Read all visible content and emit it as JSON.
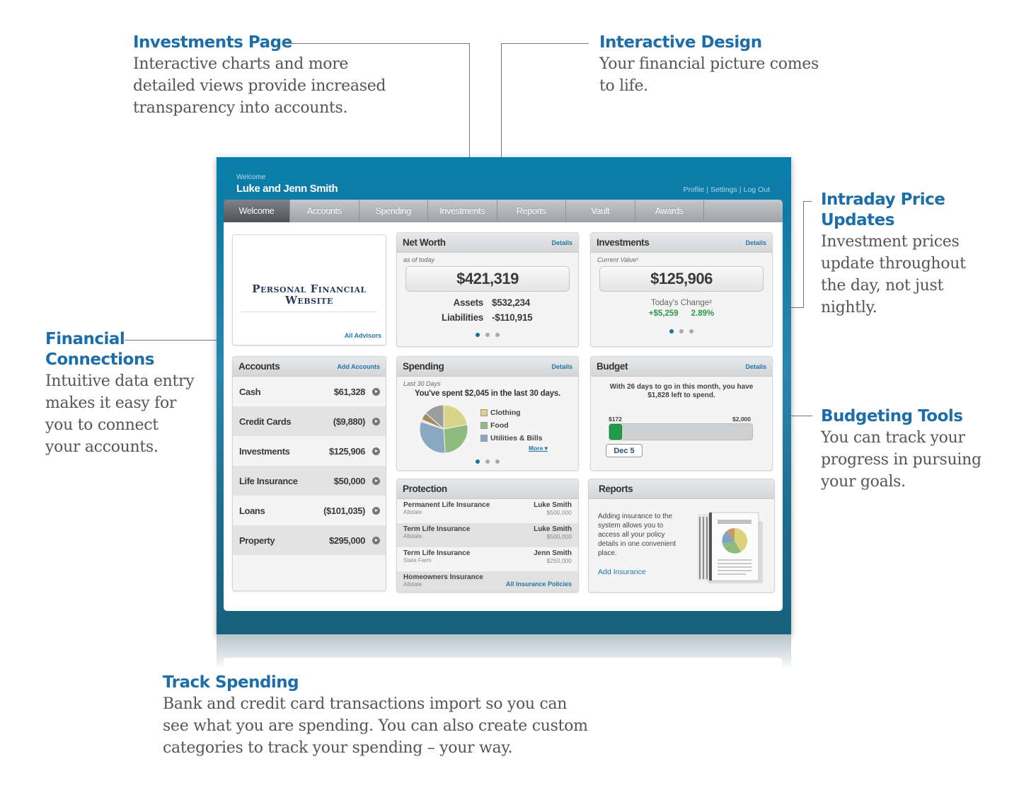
{
  "callouts": {
    "investments_page": {
      "title": "Investments Page",
      "lines": [
        "Interactive charts and more",
        "detailed views provide increased",
        "transparency into accounts."
      ]
    },
    "interactive_design": {
      "title": "Interactive Design",
      "lines": [
        "Your financial picture comes",
        "to life."
      ]
    },
    "intraday": {
      "title_lines": [
        "Intraday Price",
        "Updates"
      ],
      "lines": [
        "Investment prices",
        "update throughout",
        "the day, not just",
        "nightly."
      ]
    },
    "financial_connections": {
      "title_lines": [
        "Financial",
        "Connections"
      ],
      "lines": [
        "Intuitive data entry",
        "makes it easy for",
        "you to connect",
        "your accounts."
      ]
    },
    "budgeting_tools": {
      "title": "Budgeting Tools",
      "lines": [
        "You can track your",
        "progress in pursuing",
        "your goals."
      ]
    },
    "track_spending": {
      "title": "Track Spending",
      "lines": [
        "Bank and credit card transactions import so you can",
        "see what you are spending. You can also create custom",
        "categories to track your spending – your way."
      ]
    }
  },
  "header": {
    "welcome": "Welcome",
    "user_name": "Luke and Jenn Smith",
    "links": [
      "Profile",
      "Settings",
      "Log Out"
    ],
    "separator": "|"
  },
  "nav": {
    "tabs": [
      "Welcome",
      "Accounts",
      "Spending",
      "Investments",
      "Reports",
      "Vault",
      "Awards"
    ],
    "active": "Welcome"
  },
  "logo": {
    "line1": "Personal Financial",
    "line2": "Website",
    "all_advisors": "All Advisors"
  },
  "net_worth": {
    "title": "Net Worth",
    "details": "Details",
    "subtitle": "as of today",
    "total": "$421,319",
    "assets_label": "Assets",
    "assets": "$532,234",
    "liabilities_label": "Liabilities",
    "liabilities": "-$110,915",
    "page_index": 1,
    "page_count": 3
  },
  "investments": {
    "title": "Investments",
    "details": "Details",
    "subtitle": "Current Value¹",
    "total": "$125,906",
    "change_label": "Today's Change²",
    "change_amount": "+$5,259",
    "change_percent": "2.89%",
    "change_color": "#2b9a4d",
    "page_index": 1,
    "page_count": 3
  },
  "accounts": {
    "title": "Accounts",
    "add_link": "Add Accounts",
    "rows": [
      {
        "name": "Cash",
        "value": "$61,328"
      },
      {
        "name": "Credit Cards",
        "value": "($9,880)"
      },
      {
        "name": "Investments",
        "value": "$125,906"
      },
      {
        "name": "Life Insurance",
        "value": "$50,000"
      },
      {
        "name": "Loans",
        "value": "($101,035)"
      },
      {
        "name": "Property",
        "value": "$295,000"
      }
    ]
  },
  "spending": {
    "title": "Spending",
    "details": "Details",
    "subtitle": "Last 30 Days",
    "headline": "You've spent $2,045 in the last 30 days.",
    "legend": [
      {
        "label": "Clothing",
        "color": "#d8d48a"
      },
      {
        "label": "Food",
        "color": "#8fbb7f"
      },
      {
        "label": "Utilities & Bills",
        "color": "#8aa8c2"
      }
    ],
    "more": "More ▾",
    "page_index": 1,
    "page_count": 3
  },
  "chart_data": {
    "type": "pie",
    "title": "Spending – Last 30 Days",
    "categories": [
      "Clothing",
      "Food",
      "Utilities & Bills",
      "Other (light)",
      "Other (brown)",
      "Other (gray)"
    ],
    "values": [
      22,
      27,
      31,
      1.5,
      5,
      13.5
    ],
    "colors": [
      "#d8d48a",
      "#8fbb7f",
      "#8aa8c2",
      "#ece6d8",
      "#a88a62",
      "#9a9c9e"
    ],
    "unit": "percent (estimated)"
  },
  "budget": {
    "title": "Budget",
    "details": "Details",
    "message": "With 26 days to go in this month, you have $1,828 left to spend.",
    "spent_label": "$172",
    "limit_label": "$2,000",
    "spent": 172,
    "limit": 2000,
    "date": "Dec 5",
    "fill_color": "#1e9e48"
  },
  "protection": {
    "title": "Protection",
    "policies": [
      {
        "name": "Permanent Life Insurance",
        "company": "Allstate",
        "holder": "Luke Smith",
        "amount": "$500,000"
      },
      {
        "name": "Term Life Insurance",
        "company": "Allstate",
        "holder": "Luke Smith",
        "amount": "$500,000"
      },
      {
        "name": "Term Life Insurance",
        "company": "State Farm",
        "holder": "Jenn Smith",
        "amount": "$250,000"
      },
      {
        "name": "Homeowners Insurance",
        "company": "Allstate",
        "holder": "",
        "amount": ""
      }
    ],
    "all_link": "All Insurance Policies"
  },
  "reports": {
    "title": "Reports",
    "text": "Adding insurance to the system allows you to access all your policy details in one convenient place.",
    "link": "Add Insurance"
  },
  "colors": {
    "accent": "#1d6ea8",
    "frame_top": "#0a7fac",
    "frame_bottom": "#17617d",
    "link": "#2276a8"
  }
}
